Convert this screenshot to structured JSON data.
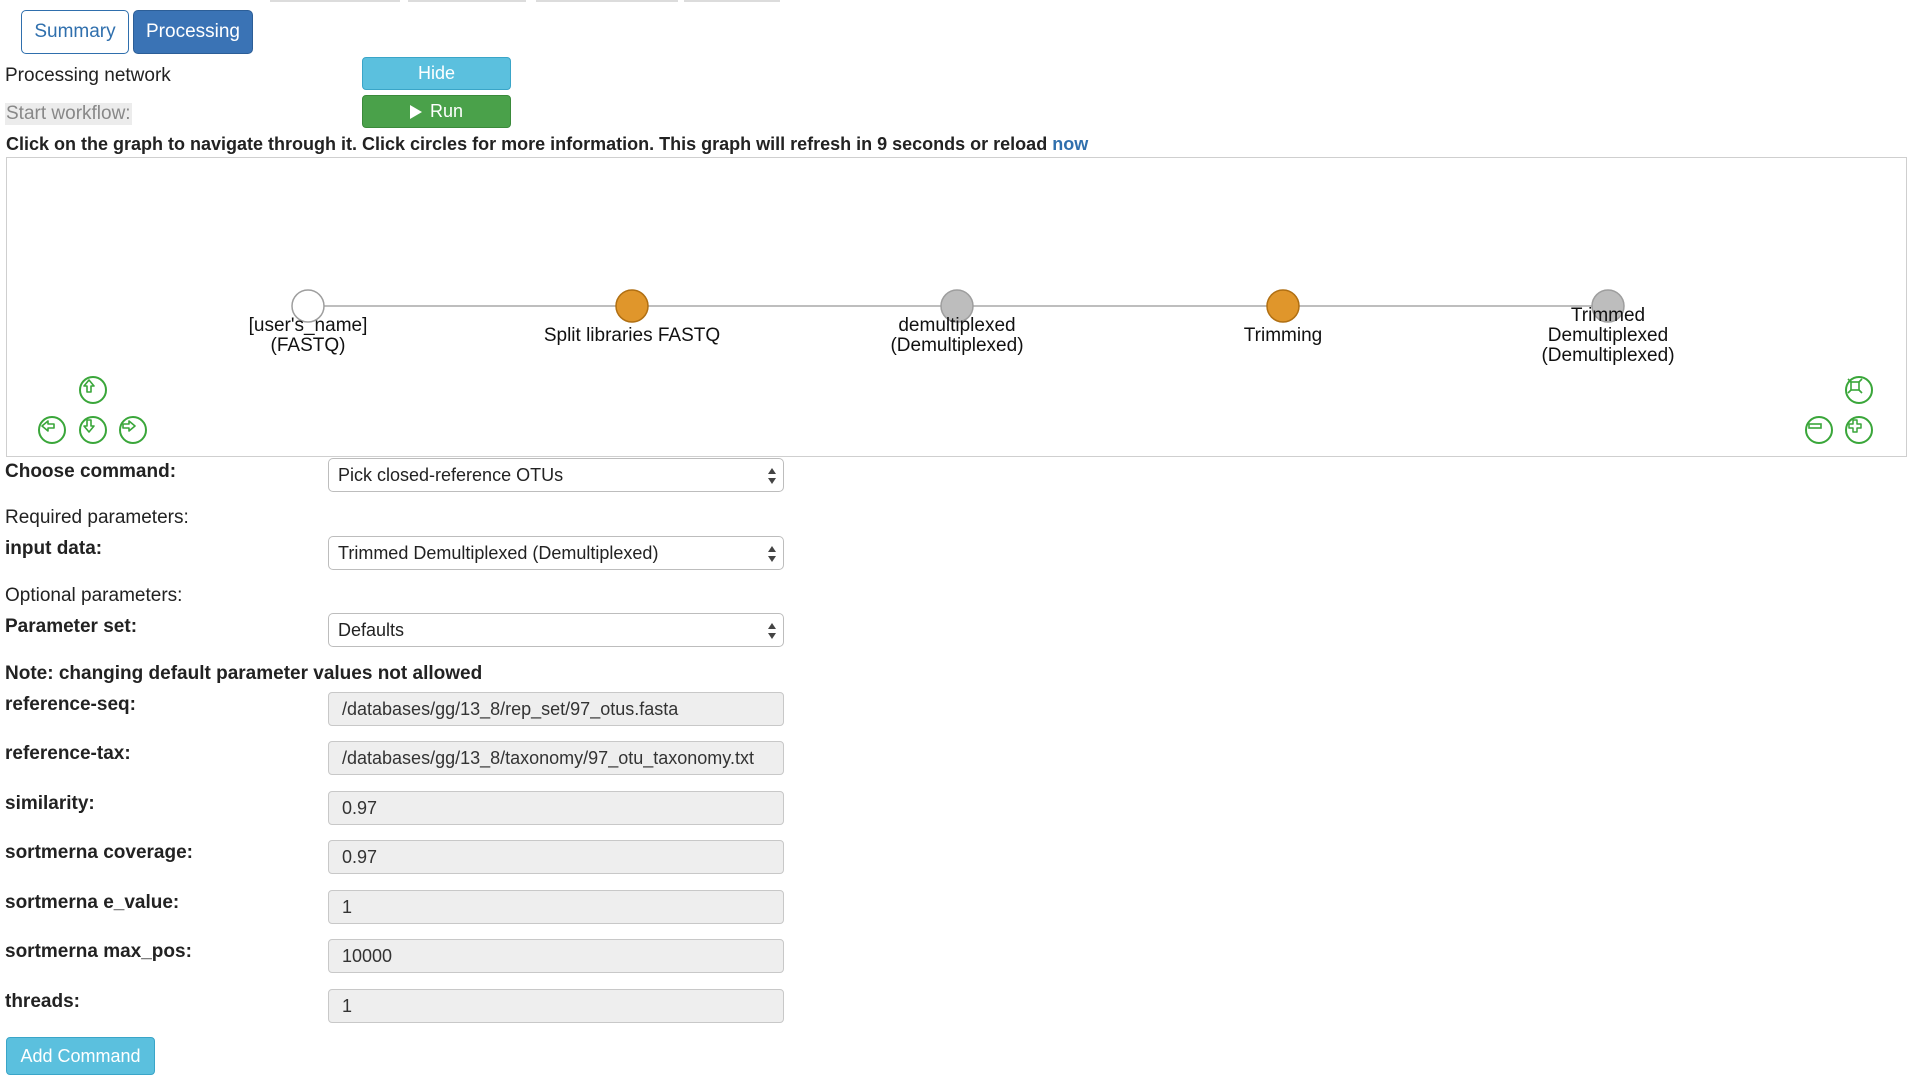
{
  "tabs": {
    "summary": "Summary",
    "processing": "Processing"
  },
  "network": {
    "label": "Processing network",
    "hide_button": "Hide",
    "start_label": "Start workflow:",
    "run_button": "Run",
    "run_icon": "play-icon"
  },
  "graph": {
    "info_text": "Click on the graph to navigate through it. Click circles for more information. This graph will refresh in 9 seconds or reload",
    "reload_link": "now",
    "nodes": [
      {
        "line1": "[user's_name]",
        "line2": "(FASTQ)",
        "line3": "",
        "kind": "artifact-input",
        "color": "#ffffff"
      },
      {
        "line1": "Split libraries FASTQ",
        "line2": "",
        "line3": "",
        "kind": "job",
        "color": "#e0962b"
      },
      {
        "line1": "demultiplexed",
        "line2": "(Demultiplexed)",
        "line3": "",
        "kind": "artifact",
        "color": "#bdbdbd"
      },
      {
        "line1": "Trimming",
        "line2": "",
        "line3": "",
        "kind": "job",
        "color": "#e0962b"
      },
      {
        "line1": "Trimmed",
        "line2": "Demultiplexed",
        "line3": "(Demultiplexed)",
        "kind": "artifact",
        "color": "#bdbdbd"
      }
    ],
    "nav_icons": [
      "arrow-up-icon",
      "arrow-left-icon",
      "arrow-down-icon",
      "arrow-right-icon"
    ],
    "zoom_icons": [
      "fit-icon",
      "zoom-out-icon",
      "zoom-in-icon"
    ],
    "accent_green": "#3aa63a"
  },
  "form": {
    "choose_command_label": "Choose command:",
    "command_value": "Pick closed-reference OTUs",
    "required_label": "Required parameters:",
    "input_data_label": "input data:",
    "input_data_value": "Trimmed Demultiplexed (Demultiplexed)",
    "optional_label": "Optional parameters:",
    "param_set_label": "Parameter set:",
    "param_set_value": "Defaults",
    "note": "Note: changing default parameter values not allowed",
    "params": [
      {
        "label": "reference-seq:",
        "value": "/databases/gg/13_8/rep_set/97_otus.fasta"
      },
      {
        "label": "reference-tax:",
        "value": "/databases/gg/13_8/taxonomy/97_otu_taxonomy.txt"
      },
      {
        "label": "similarity:",
        "value": "0.97"
      },
      {
        "label": "sortmerna coverage:",
        "value": "0.97"
      },
      {
        "label": "sortmerna e_value:",
        "value": "1"
      },
      {
        "label": "sortmerna max_pos:",
        "value": "10000"
      },
      {
        "label": "threads:",
        "value": "1"
      }
    ],
    "add_button": "Add Command"
  }
}
